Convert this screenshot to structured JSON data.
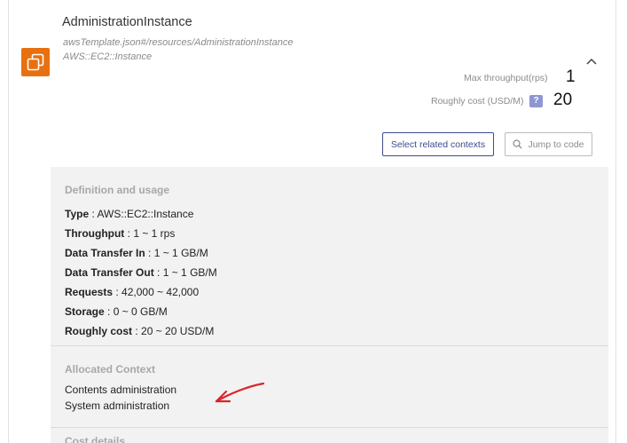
{
  "resource": {
    "title": "AdministrationInstance",
    "path": "awsTemplate.json#/resources/AdministrationInstance",
    "type_line": "AWS::EC2::Instance",
    "icon": "ec2-instance-icon",
    "icon_color": "#e8700f"
  },
  "metrics": {
    "throughput_label": "Max throughput(rps)",
    "throughput_value": "1",
    "cost_label": "Roughly cost (USD/M)",
    "cost_help": "?",
    "cost_value": "20"
  },
  "actions": {
    "select_related": "Select related contexts",
    "jump_to_code": "Jump to code"
  },
  "definition": {
    "title": "Definition and usage",
    "rows": [
      {
        "key": "Type",
        "value": " : AWS::EC2::Instance"
      },
      {
        "key": "Throughput",
        "value": " : 1 ~ 1 rps"
      },
      {
        "key": "Data Transfer In",
        "value": " : 1 ~ 1 GB/M"
      },
      {
        "key": "Data Transfer Out",
        "value": " : 1 ~ 1 GB/M"
      },
      {
        "key": "Requests",
        "value": " : 42,000 ~ 42,000"
      },
      {
        "key": "Storage",
        "value": " : 0 ~ 0 GB/M"
      },
      {
        "key": "Roughly cost",
        "value": " : 20 ~ 20 USD/M"
      }
    ]
  },
  "allocated": {
    "title": "Allocated Context",
    "items": [
      "Contents administration",
      "System administration"
    ]
  },
  "cost_details": {
    "title": "Cost details"
  },
  "colors": {
    "accent": "#3e4a8e",
    "annotation": "#d9262b",
    "help_badge": "#8e96d4"
  }
}
